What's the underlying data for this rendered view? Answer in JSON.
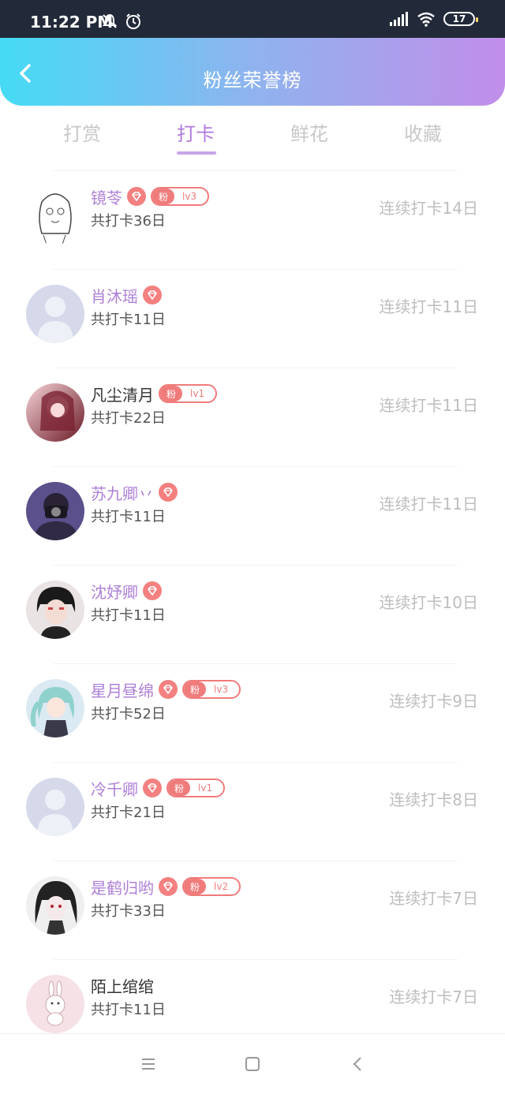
{
  "status_bar": {
    "time": "11:22 PM",
    "battery": "17",
    "icons_left": [
      "bell-off-icon",
      "alarm-icon"
    ],
    "icons_right": [
      "hd-signal-icon",
      "wifi-icon",
      "battery-icon"
    ]
  },
  "header": {
    "title": "粉丝荣誉榜",
    "back_icon": "chevron-left-icon"
  },
  "tabs": [
    {
      "label": "打赏",
      "active": false
    },
    {
      "label": "打卡",
      "active": true
    },
    {
      "label": "鲜花",
      "active": false
    },
    {
      "label": "收藏",
      "active": false
    }
  ],
  "list": [
    {
      "name": "镜苓",
      "total": "共打卡36日",
      "streak": "连续打卡14日",
      "name_color": "purple",
      "diamond": true,
      "fan": {
        "label": "粉",
        "level": "lv3"
      },
      "avatar": "sketch-girl-avatar"
    },
    {
      "name": "肖沐瑶",
      "total": "共打卡11日",
      "streak": "连续打卡11日",
      "name_color": "purple",
      "diamond": true,
      "fan": null,
      "avatar": "default-avatar"
    },
    {
      "name": "凡尘清月",
      "total": "共打卡22日",
      "streak": "连续打卡11日",
      "name_color": "black",
      "diamond": false,
      "fan": {
        "label": "粉",
        "level": "lv1"
      },
      "avatar": "red-anime-avatar"
    },
    {
      "name": "苏九卿丷",
      "total": "共打卡11日",
      "streak": "连续打卡11日",
      "name_color": "purple",
      "diamond": true,
      "fan": null,
      "avatar": "purple-photo-avatar"
    },
    {
      "name": "沈妤卿",
      "total": "共打卡11日",
      "streak": "连续打卡10日",
      "name_color": "purple",
      "diamond": true,
      "fan": null,
      "avatar": "dark-hair-avatar"
    },
    {
      "name": "星月昼绵",
      "total": "共打卡52日",
      "streak": "连续打卡9日",
      "name_color": "purple",
      "diamond": true,
      "fan": {
        "label": "粉",
        "level": "lv3"
      },
      "avatar": "teal-hair-avatar"
    },
    {
      "name": "冷千卿",
      "total": "共打卡21日",
      "streak": "连续打卡8日",
      "name_color": "purple",
      "diamond": true,
      "fan": {
        "label": "粉",
        "level": "lv1"
      },
      "avatar": "default-avatar"
    },
    {
      "name": "是鹤归哟",
      "total": "共打卡33日",
      "streak": "连续打卡7日",
      "name_color": "purple",
      "diamond": true,
      "fan": {
        "label": "粉",
        "level": "lv2"
      },
      "avatar": "monochrome-girl-avatar"
    },
    {
      "name": "陌上绾绾",
      "total": "共打卡11日",
      "streak": "连续打卡7日",
      "name_color": "black",
      "diamond": false,
      "fan": null,
      "avatar": "pink-bunny-avatar"
    }
  ],
  "bottom_nav": [
    "menu-icon",
    "home-square-icon",
    "back-triangle-icon"
  ],
  "colors": {
    "accent_purple": "#ad7fd7",
    "badge_red": "#f07b7b",
    "streak_gray": "#bdbdbd",
    "header_start": "#45dbf5",
    "header_end": "#c18ee9"
  }
}
